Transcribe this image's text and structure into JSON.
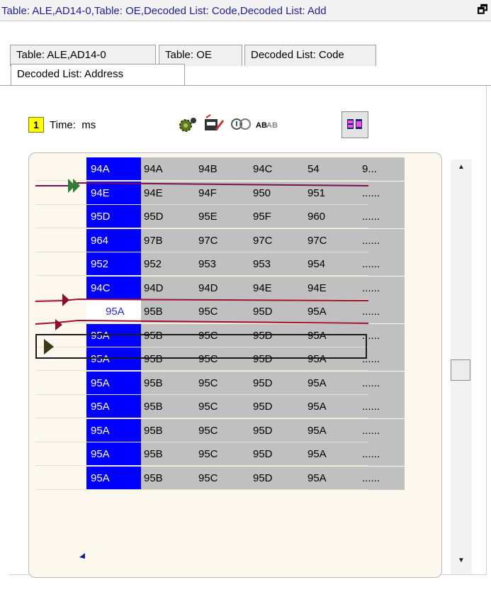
{
  "window": {
    "title": "Table: ALE,AD14-0,Table: OE,Decoded List: Code,Decoded List: Add",
    "restore_icon": "restore-window-icon"
  },
  "tabs": [
    {
      "label": "Table: ALE,AD14-0",
      "active": false
    },
    {
      "label": "Table: OE",
      "active": false
    },
    {
      "label": "Decoded List: Code",
      "active": false
    },
    {
      "label": "Decoded List: Address",
      "active": true
    }
  ],
  "toolbar": {
    "cursor_number": "1",
    "time_label": "Time:",
    "time_unit": "ms",
    "icons": [
      "gear-icon",
      "filter-icon",
      "search-icon",
      "ab-text-icon",
      "split-view-icon"
    ]
  },
  "rows": [
    {
      "addr": "94A",
      "values": [
        "94A",
        "94B",
        "94C",
        "54",
        "9..."
      ]
    },
    {
      "addr": "94E",
      "values": [
        "94E",
        "94F",
        "950",
        "951",
        "......"
      ]
    },
    {
      "addr": "95D",
      "values": [
        "95D",
        "95E",
        "95F",
        "960",
        "......"
      ]
    },
    {
      "addr": "964",
      "values": [
        "97B",
        "97C",
        "97C",
        "97C",
        "......"
      ]
    },
    {
      "addr": "952",
      "values": [
        "952",
        "953",
        "953",
        "954",
        "......"
      ]
    },
    {
      "addr": "94C",
      "values": [
        "94D",
        "94D",
        "94E",
        "94E",
        "......"
      ]
    },
    {
      "addr": "95A",
      "values": [
        "95B",
        "95C",
        "95D",
        "95A",
        "......"
      ],
      "selected": true
    },
    {
      "addr": "95A",
      "values": [
        "95B",
        "95C",
        "95D",
        "95A",
        "......"
      ]
    },
    {
      "addr": "95A",
      "values": [
        "95B",
        "95C",
        "95D",
        "95A",
        "......"
      ]
    },
    {
      "addr": "95A",
      "values": [
        "95B",
        "95C",
        "95D",
        "95A",
        "......"
      ]
    },
    {
      "addr": "95A",
      "values": [
        "95B",
        "95C",
        "95D",
        "95A",
        "......"
      ]
    },
    {
      "addr": "95A",
      "values": [
        "95B",
        "95C",
        "95D",
        "95A",
        "......"
      ]
    },
    {
      "addr": "95A",
      "values": [
        "95B",
        "95C",
        "95D",
        "95A",
        "......"
      ]
    },
    {
      "addr": "95A",
      "values": [
        "95B",
        "95C",
        "95D",
        "95A",
        "......"
      ]
    }
  ],
  "colors": {
    "address_bg": "#0000ff",
    "value_bg": "#c0c0c0",
    "marker_dark_red": "#8b0f2a",
    "marker_green": "#2e7d32",
    "cursor_badge": "#ffff00"
  }
}
